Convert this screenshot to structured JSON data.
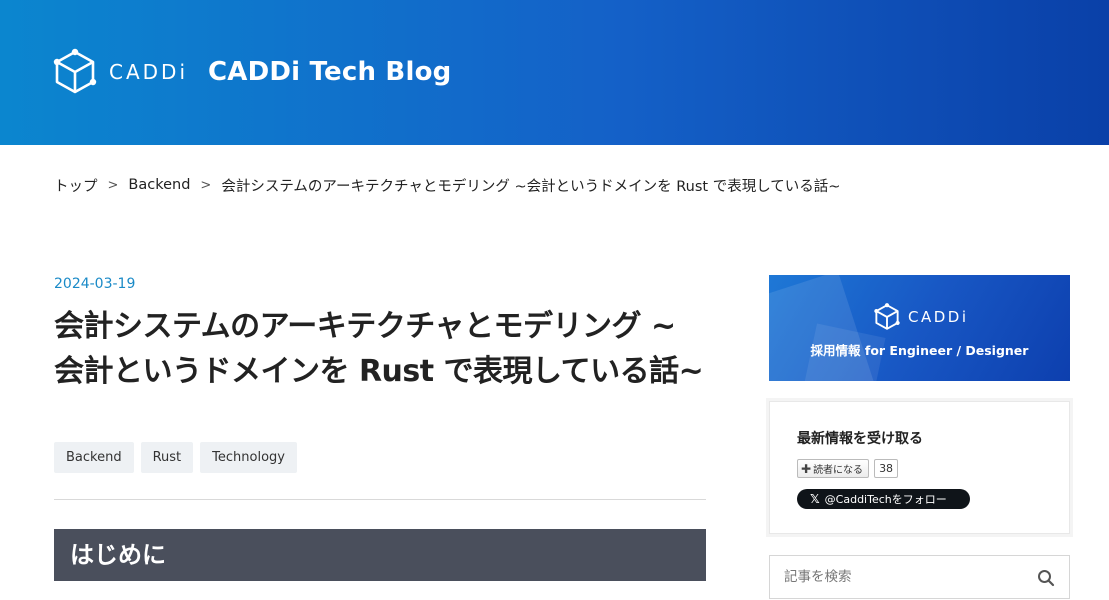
{
  "header": {
    "wordmark": "CADDi",
    "blog_title": "CADDi Tech Blog"
  },
  "breadcrumb": {
    "items": [
      "トップ",
      "Backend",
      "会計システムのアーキテクチャとモデリング ~会計というドメインを Rust で表現している話~"
    ],
    "separator": ">"
  },
  "article": {
    "date": "2024-03-19",
    "title": "会計システムのアーキテクチャとモデリング ~会計というドメインを Rust で表現している話~",
    "tags": [
      "Backend",
      "Rust",
      "Technology"
    ],
    "section_heading": "はじめに"
  },
  "sidebar": {
    "recruit_banner": {
      "wordmark": "CADDi",
      "text": "採用情報 for Engineer / Designer"
    },
    "subscribe": {
      "title": "最新情報を受け取る",
      "reader_button": "読者になる",
      "reader_count": "38",
      "follow_button": "@CaddiTechをフォロー"
    },
    "search": {
      "placeholder": "記事を検索"
    }
  }
}
